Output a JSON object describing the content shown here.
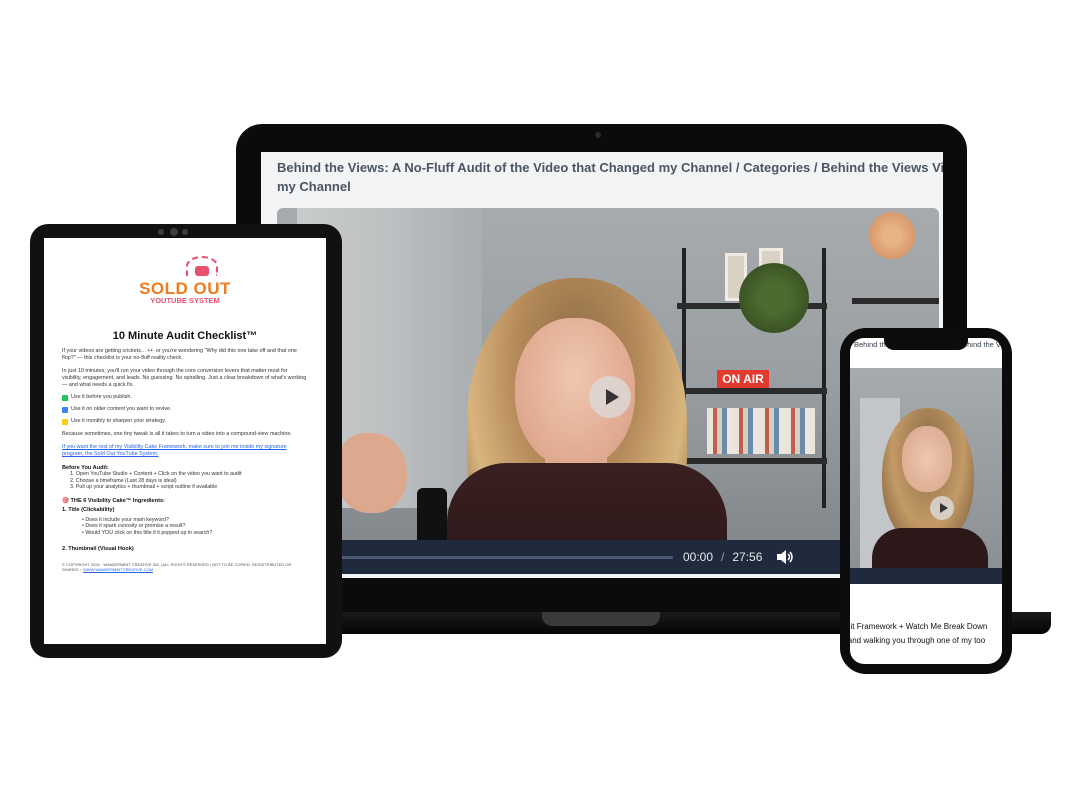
{
  "laptop": {
    "title_line1": "Behind the Views: A No-Fluff Audit of the Video that Changed my Channel / Categories / Behind the Views Video Audit / Be",
    "title_line2": "my Channel",
    "video": {
      "sign_text": "ON AIR",
      "current_time": "00:00",
      "separator": "/",
      "duration": "27:56",
      "progress": 0
    },
    "icons": [
      "play-icon",
      "fast-forward-icon",
      "volume-icon"
    ]
  },
  "tablet": {
    "logo_line1": "SOLD OUT",
    "logo_line2": "YOUTUBE SYSTEM",
    "doc_title": "10 Minute Audit Checklist™",
    "intro_p1": "If your videos are getting crickets… 👀 or you're wondering \"Why did this one take off and that one flop?\" — this checklist is your no-fluff reality check.",
    "intro_p2": "In just 10 minutes, you'll run your video through the core conversion levers that matter most for visibility, engagement, and leads. No guessing. No spiralling. Just a clear breakdown of what's working — and what needs a quick fix.",
    "uses": [
      {
        "text": "Use it before you publish.",
        "color": "#22c55e"
      },
      {
        "text": "Use it on older content you want to revive.",
        "color": "#3b82f6"
      },
      {
        "text": "Use it monthly to sharpen your strategy.",
        "color": "#facc15"
      }
    ],
    "because_p": "Because sometimes, one tiny tweak is all it takes to turn a video into a compound-view machine.",
    "link_text": "If you want the rest of my Visibility Cake Framework, make sure to join me inside my signature program, the Sold Out YouTube System.",
    "before_heading": "Before You Audit:",
    "before_steps": [
      "1.   Open YouTube Studio + Content + Click on the video you want to audit",
      "2.   Choose a timeframe (Last 28 days is ideal)",
      "3.   Pull up your analytics + thumbnail + script outline if available"
    ],
    "ingredients_heading": "🎯 THE 6 Visibility Cake™ Ingredients:",
    "title_heading": "1. Title (Clickability)",
    "title_bullets": [
      "Does it include your main keyword?",
      "Does it spark curiosity or promise a result?",
      "Would YOU click on this title if it popped up in search?"
    ],
    "thumb_heading": "2. Thumbnail (Visual Hook)",
    "footer_text": "© COPYRIGHT 2024 · WANDERMINT CREATIVE INC | ALL RIGHTS RESERVED | NOT TO BE COPIED, REDISTRIBUTED OR SHARED ::",
    "footer_link": "WWW.WANDERMINTCREATIVE.COM"
  },
  "phone": {
    "title": "Behind the Views Video Audit / Behind the Views: A No-Fluff Audit of the Video that Changed my Channel / Ca",
    "text_line1": "n Audit Framework + Watch Me Break Down",
    "text_line2": "rtain and walking you through one of my too"
  },
  "colors": {
    "accent_orange": "#f07a1e",
    "accent_pink": "#e94f6e",
    "control_bar": "#1f2a3d",
    "link_blue": "#2563eb"
  }
}
